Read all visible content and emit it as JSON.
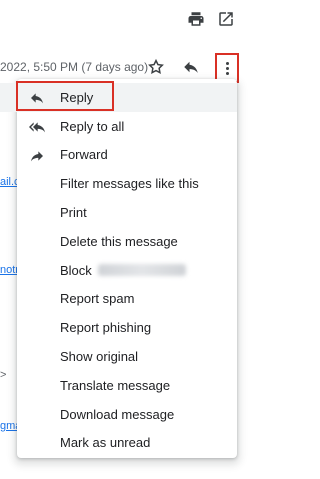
{
  "header": {
    "datetime": "2022, 5:50 PM (7 days ago)"
  },
  "left_fragments": [
    "ail.c",
    "notm",
    ">",
    "gma"
  ],
  "menu": {
    "items": [
      {
        "label": "Reply",
        "icon": "reply-icon"
      },
      {
        "label": "Reply to all",
        "icon": "reply-all-icon"
      },
      {
        "label": "Forward",
        "icon": "forward-icon"
      },
      {
        "label": "Filter messages like this"
      },
      {
        "label": "Print"
      },
      {
        "label": "Delete this message"
      },
      {
        "label": "Block"
      },
      {
        "label": "Report spam"
      },
      {
        "label": "Report phishing"
      },
      {
        "label": "Show original"
      },
      {
        "label": "Translate message"
      },
      {
        "label": "Download message"
      },
      {
        "label": "Mark as unread"
      }
    ]
  },
  "colors": {
    "highlight": "#d93025",
    "hover": "#f1f3f4",
    "link": "#1a73e8"
  }
}
